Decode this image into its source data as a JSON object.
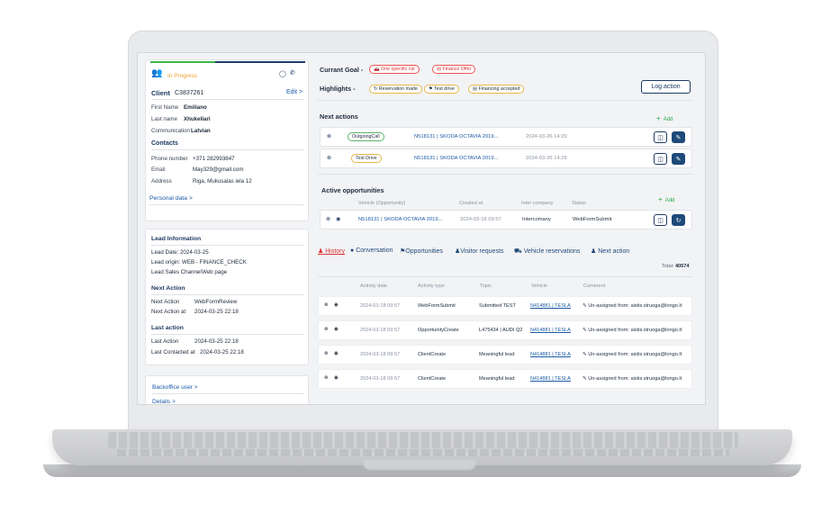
{
  "client": {
    "status": "In Progress",
    "label": "Client",
    "id": "C3837261",
    "edit": "Edit >",
    "fields": [
      {
        "label": "First Name",
        "value": "Emiliano"
      },
      {
        "label": "Last name",
        "value": "Xhukellari"
      },
      {
        "label": "Communication",
        "value": "Latvian"
      }
    ],
    "contacts_title": "Contacts",
    "contacts": [
      {
        "label": "Phone number",
        "value": "+371 282993847"
      },
      {
        "label": "Email",
        "value": "May329@gmail.com"
      },
      {
        "label": "Address",
        "value": "Riga, Mukusalas iela 12"
      }
    ],
    "personal_data": "Personal data >"
  },
  "lead": {
    "title": "Lead Information",
    "date": "Lead Date: 2024-03-25",
    "origin": "Lead origin:  WEB - FINANCE_CHECK",
    "channel_label": "Lead Sales Channel",
    "channel_value": "Web page",
    "next_action_title": "Next Action",
    "next_action_label": "Next Action",
    "next_action_value": "WebFormReview",
    "next_action_at_label": "Next Action at",
    "next_action_at_value": "2024-03-25 22:18",
    "last_action_title": "Last action",
    "last_action_label": "Last  Action",
    "last_action_value": "2024-03-25 22:18",
    "last_contacted_label": "Last  Contacted at",
    "last_contacted_value": "2024-03-25 22:18"
  },
  "backoffice": {
    "user": "Backoffice user >",
    "details": "Details >"
  },
  "goal": {
    "label": "Currant Goal -",
    "pills": [
      "One specific car",
      "Finance Offer"
    ]
  },
  "highlights": {
    "label": "Highlights  -",
    "pills": [
      "Reservation made",
      "Test drive",
      "Financing accepted"
    ]
  },
  "log_action": "Log action",
  "next_actions": {
    "title": "Next actions",
    "add": "Add",
    "rows": [
      {
        "type": "OutgoingCall",
        "vehicle": "N518131 | SKODA OCTAVIA 2019...",
        "date": "2024-03-26 14:29"
      },
      {
        "type": "Test Drive",
        "vehicle": "N518131 | SKODA OCTAVIA 2019...",
        "date": "2024-03-26 14:29"
      }
    ]
  },
  "opportunities": {
    "title": "Active opportunities",
    "add": "Add",
    "headers": [
      "Vehicle (Opportunity)",
      "Created at",
      "Inter company",
      "Status"
    ],
    "rows": [
      {
        "vehicle": "N518131 | SKODA OCTAVIA 2019...",
        "created": "2024-03-18 09:57",
        "company": "Intercomany",
        "status": "WebFormSubmit"
      }
    ]
  },
  "tabs": [
    "History",
    "Conversation",
    "Opportunities",
    "Visitor requests",
    "Vehicle reservations",
    "Next action"
  ],
  "history": {
    "total_label": "Total:",
    "total_value": "40574",
    "headers": [
      "Activity date",
      "Activity type",
      "Topic",
      "Vehicle",
      "Comment"
    ],
    "rows": [
      {
        "date": "2024-03-18 09:57",
        "type": "WebFormSubmit",
        "topic": "Submitted TEST",
        "vehicle": "N414881 | TESLA",
        "comment": "Un-assigned from: aistis.struoga@longo.lt"
      },
      {
        "date": "2024-03-18 09:57",
        "type": "OpportunityCreate",
        "topic": "L475434 | AUDI Q2",
        "vehicle": "N414881 | TESLA",
        "comment": "Un-assigned from: aistis.struoga@longo.lt"
      },
      {
        "date": "2024-03-18 09:57",
        "type": "ClientCreate",
        "topic": "Meaningful lead",
        "vehicle": "N414881 | TESLA",
        "comment": "Un-assigned from: aistis.struoga@longo.lt"
      },
      {
        "date": "2024-03-18 09:57",
        "type": "ClientCreate",
        "topic": "Meaningful lead",
        "vehicle": "N414881 | TESLA",
        "comment": "Un-assigned from: aistis.struoga@longo.lt"
      }
    ]
  },
  "colors": {
    "navy": "#1d3a63",
    "progress_green": "#3bb54a",
    "status_orange": "#f0a22e",
    "add_green": "#2aa84a"
  }
}
